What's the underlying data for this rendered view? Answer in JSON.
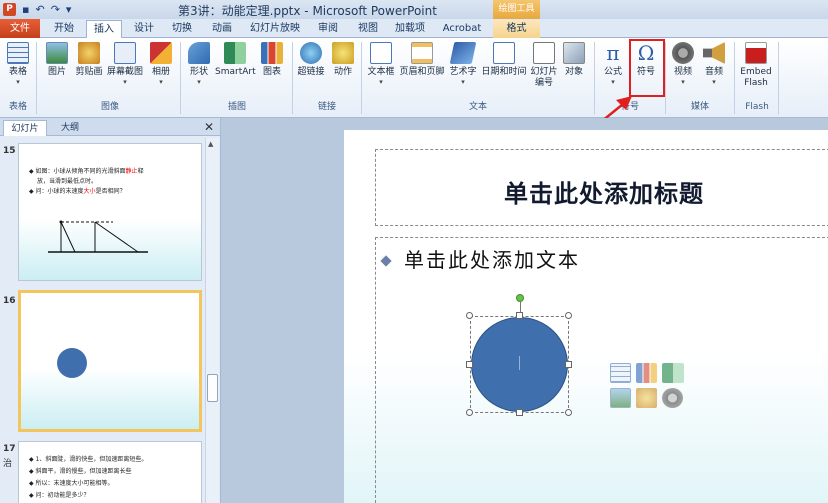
{
  "window": {
    "title": "第3讲：动能定理.pptx - Microsoft PowerPoint",
    "contextual_tool": "绘图工具"
  },
  "tabs": [
    "文件",
    "开始",
    "插入",
    "设计",
    "切换",
    "动画",
    "幻灯片放映",
    "审阅",
    "视图",
    "加载项",
    "Acrobat",
    "格式"
  ],
  "ribbon": {
    "buttons": [
      {
        "label": "表格",
        "arrow": "▾"
      },
      {
        "label": "图片",
        "arrow": ""
      },
      {
        "label": "剪贴画",
        "arrow": ""
      },
      {
        "label": "屏幕截图",
        "arrow": "▾"
      },
      {
        "label": "相册",
        "arrow": "▾"
      },
      {
        "label": "形状",
        "arrow": "▾"
      },
      {
        "label": "SmartArt",
        "arrow": ""
      },
      {
        "label": "图表",
        "arrow": ""
      },
      {
        "label": "超链接",
        "arrow": ""
      },
      {
        "label": "动作",
        "arrow": ""
      },
      {
        "label": "文本框",
        "arrow": "▾"
      },
      {
        "label": "页眉和页脚",
        "arrow": ""
      },
      {
        "label": "艺术字",
        "arrow": "▾"
      },
      {
        "label": "日期和时间",
        "arrow": ""
      },
      {
        "label": "幻灯片\n编号",
        "arrow": ""
      },
      {
        "label": "对象",
        "arrow": ""
      },
      {
        "label": "公式",
        "arrow": "▾"
      },
      {
        "label": "符号",
        "arrow": ""
      },
      {
        "label": "视频",
        "arrow": "▾"
      },
      {
        "label": "音频",
        "arrow": "▾"
      },
      {
        "label": "Embed\nFlash",
        "arrow": ""
      }
    ],
    "groups": [
      "表格",
      "图像",
      "插图",
      "链接",
      "文本",
      "符号",
      "媒体",
      "Flash"
    ]
  },
  "panel": {
    "tabs": [
      "幻灯片",
      "大纲"
    ],
    "close": "✕",
    "slides": [
      {
        "number": "15",
        "lines": [
          {
            "text_a": "如图：小球从倾角不同的光滑斜面",
            "red": "静止",
            "text_b": "释"
          },
          {
            "text_a": "放，当滑到最低点时。",
            "red": "",
            "text_b": ""
          },
          {
            "text_a": "问：小球的末速度",
            "red": "大小",
            "text_b": "是否相同？"
          }
        ]
      },
      {
        "number": "16",
        "lines": []
      },
      {
        "number": "17",
        "lines": [
          {
            "text_a": "1、斜面陡，滑的快些，但加速距离短些。",
            "red": "",
            "text_b": ""
          },
          {
            "text_a": "   斜面平，滑的慢些，但加速距离长些",
            "red": "",
            "text_b": ""
          },
          {
            "text_a": "所以：末速度大小可能相等。",
            "red": "",
            "text_b": ""
          },
          {
            "text_a": "问：初动能是多少？",
            "red": "",
            "text_b": ""
          }
        ]
      }
    ],
    "slide17_sidelabel": "治"
  },
  "slide": {
    "title_placeholder": "单击此处添加标题",
    "body_placeholder": "单击此处添加文本"
  },
  "colors": {
    "accent_file_tab": "#c3401c",
    "highlight_box": "#e02020",
    "circle_fill": "#3f6fac",
    "selected_thumb": "#f2c55d"
  }
}
